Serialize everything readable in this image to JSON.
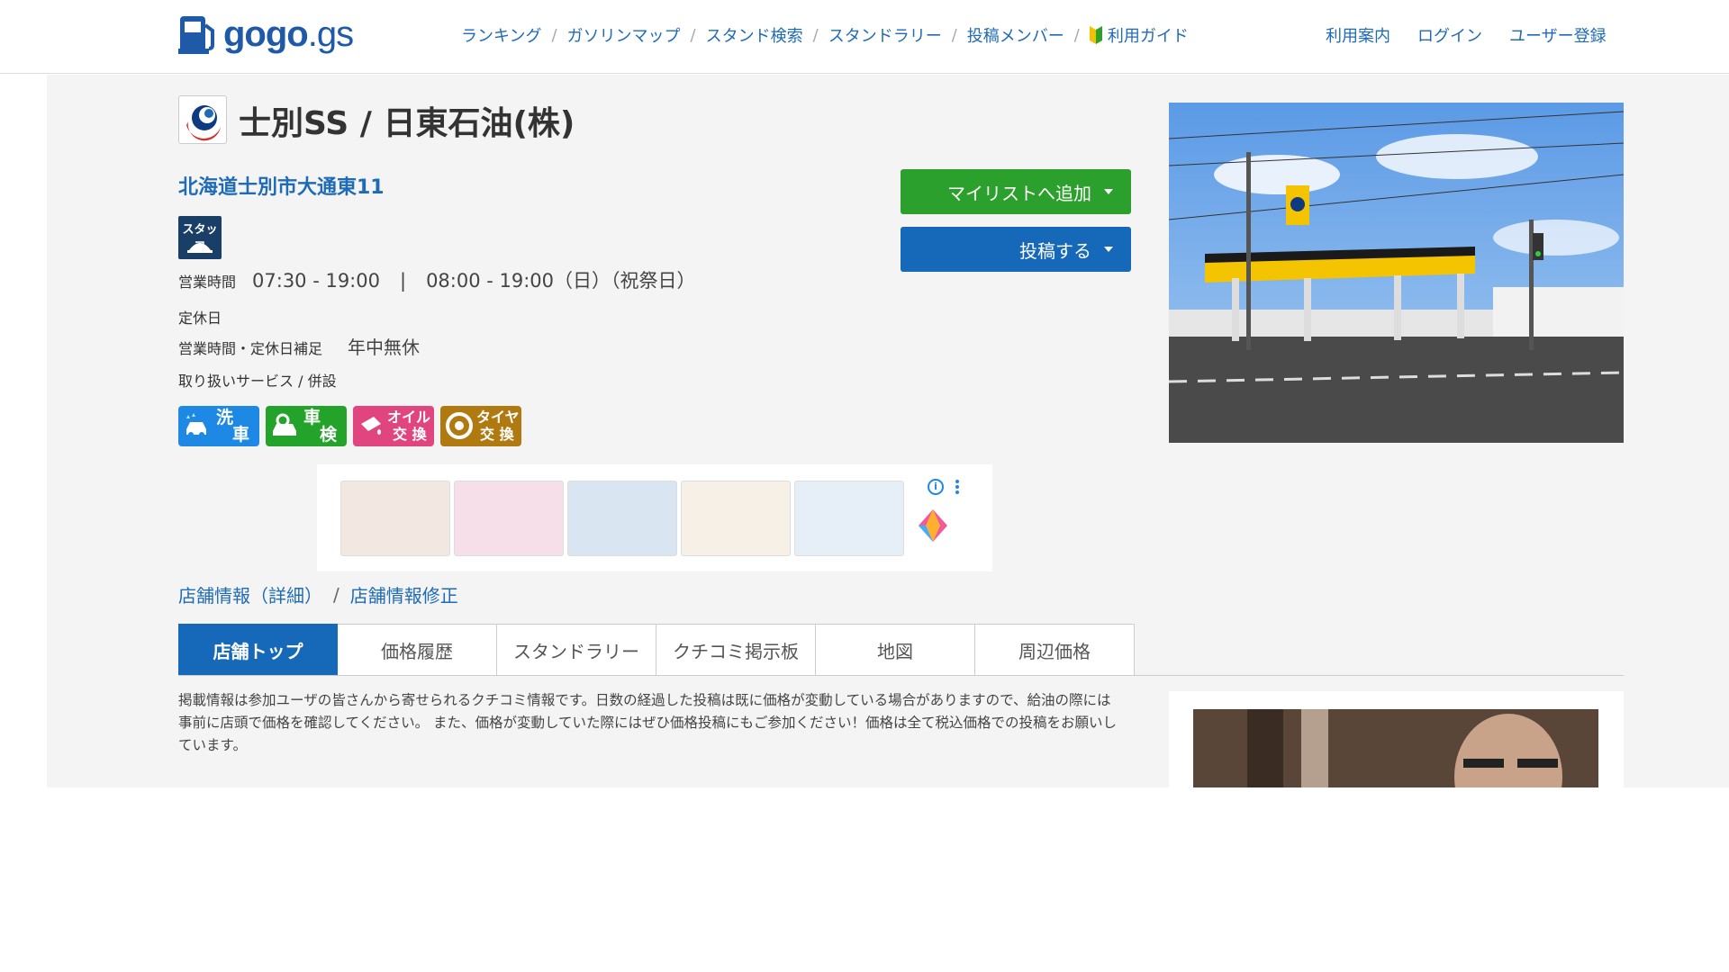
{
  "header": {
    "logo_text": "gogo",
    "logo_suffix": ".gs",
    "nav": [
      {
        "label": "ランキング"
      },
      {
        "label": "ガソリンマップ"
      },
      {
        "label": "スタンド検索"
      },
      {
        "label": "スタンドラリー"
      },
      {
        "label": "投稿メンバー"
      },
      {
        "label": "利用ガイド"
      }
    ],
    "nav_separator": "/",
    "right_links": [
      {
        "label": "利用案内"
      },
      {
        "label": "ログイン"
      },
      {
        "label": "ユーザー登録"
      }
    ]
  },
  "station": {
    "title": "士別SS / 日東石油(株)",
    "address": "北海道士別市大通東11",
    "staff_badge": "スタッフ",
    "hours_label": "営業時間",
    "hours_weekday": "07:30 - 19:00",
    "hours_separator": "|",
    "hours_holiday": "08:00 - 19:00（日）（祝祭日）",
    "closed_label": "定休日",
    "supplement_label": "営業時間・定休日補足",
    "supplement_value": "年中無休",
    "services_label": "取り扱いサービス / 併設",
    "services": [
      {
        "l1": "洗",
        "l2": "車",
        "icon": "car-wash-icon"
      },
      {
        "l1": "車",
        "l2": "検",
        "icon": "car-inspection-icon"
      },
      {
        "l1": "オイル",
        "l2": "交 換",
        "icon": "oil-change-icon"
      },
      {
        "l1": "タイヤ",
        "l2": "交 換",
        "icon": "tire-change-icon"
      }
    ]
  },
  "actions": {
    "mylist_label": "マイリストへ追加",
    "post_label": "投稿する"
  },
  "ad": {
    "info": "i"
  },
  "store_links": {
    "detail": "店舗情報（詳細）",
    "separator": "/",
    "edit": "店舗情報修正"
  },
  "tabs": [
    {
      "label": "店舗トップ",
      "active": true
    },
    {
      "label": "価格履歴"
    },
    {
      "label": "スタンドラリー"
    },
    {
      "label": "クチコミ掲示板"
    },
    {
      "label": "地図"
    },
    {
      "label": "周辺価格"
    }
  ],
  "notice": "掲載情報は参加ユーザの皆さんから寄せられるクチコミ情報です。日数の経過した投稿は既に価格が変動している場合がありますので、給油の際には事前に店頭で価格を確認してください。 また、価格が変動していた際にはぜひ価格投稿にもご参加ください！価格は全て税込価格での投稿をお願いしています。",
  "colors": {
    "brand_blue": "#1f5aa8",
    "link_blue": "#1f6bb5",
    "button_green": "#2ca02c",
    "button_blue": "#1668b8"
  }
}
